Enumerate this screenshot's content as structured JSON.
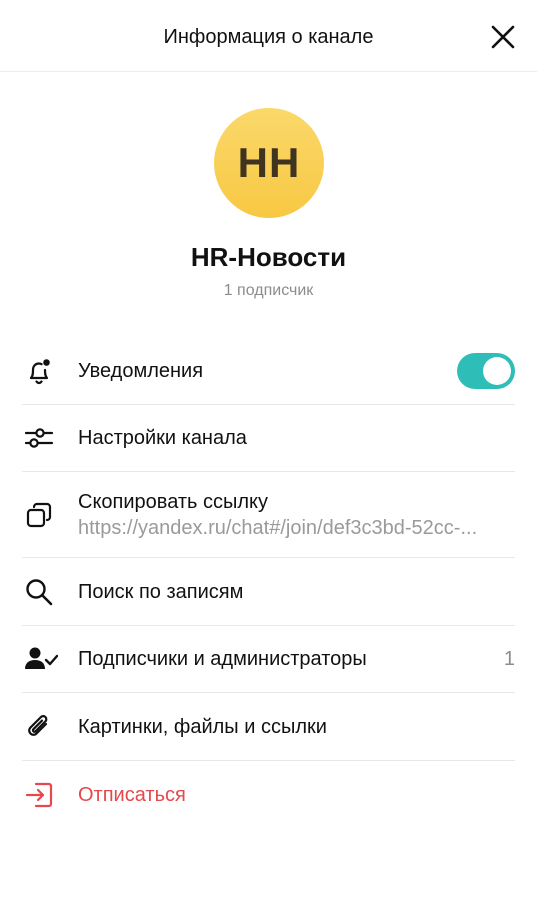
{
  "header": {
    "title": "Информация о канале"
  },
  "channel": {
    "initials": "HH",
    "name": "HR-Новости",
    "subscribers": "1 подписчик",
    "avatar_color": "#f7c843"
  },
  "accent_color": "#2fbdb8",
  "danger_color": "#e5484d",
  "menu": {
    "notifications": {
      "label": "Уведомления",
      "enabled": true,
      "icon": "bell-icon"
    },
    "settings": {
      "label": "Настройки канала",
      "icon": "sliders-icon"
    },
    "copy_link": {
      "label": "Скопировать ссылку",
      "url": "https://yandex.ru/chat#/join/def3c3bd-52cc-...",
      "icon": "copy-icon"
    },
    "search": {
      "label": "Поиск по записям",
      "icon": "search-icon"
    },
    "members": {
      "label": "Подписчики и администраторы",
      "count": "1",
      "icon": "user-check-icon"
    },
    "media": {
      "label": "Картинки, файлы и ссылки",
      "icon": "paperclip-icon"
    },
    "unsubscribe": {
      "label": "Отписаться",
      "icon": "exit-icon"
    }
  }
}
